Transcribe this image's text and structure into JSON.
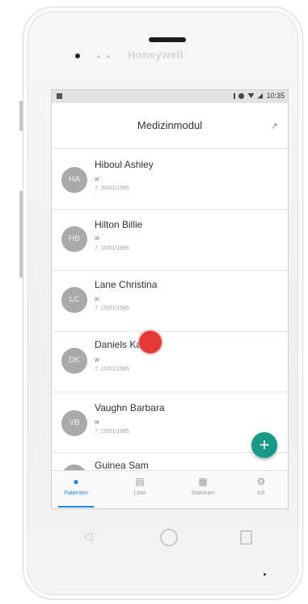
{
  "device": {
    "brand": "Honeywell"
  },
  "statusbar": {
    "time": "10:35"
  },
  "appbar": {
    "title": "Medizinmodul",
    "expand_icon": "expand-icon"
  },
  "patients": [
    {
      "initials": "HA",
      "name": "Hiboul Ashley",
      "sex": "w",
      "dob": "7. 30/01/1985"
    },
    {
      "initials": "HB",
      "name": "Hilton Billie",
      "sex": "w",
      "dob": "7. 15/01/1985"
    },
    {
      "initials": "LC",
      "name": "Lane Christina",
      "sex": "w",
      "dob": "7. 15/01/1985"
    },
    {
      "initials": "DK",
      "name": "Daniels Karen",
      "sex": "w",
      "dob": "7. 15/01/1985"
    },
    {
      "initials": "VB",
      "name": "Vaughn Barbara",
      "sex": "w",
      "dob": "7. 15/01/1985"
    },
    {
      "initials": "GS",
      "name": "Guinea Sam",
      "sex": "",
      "dob": ""
    }
  ],
  "fab": {
    "label": "+"
  },
  "bottomnav": [
    {
      "label": "Patienten",
      "icon": "person-icon",
      "active": true
    },
    {
      "label": "Liste",
      "icon": "list-icon",
      "active": false
    },
    {
      "label": "Stationen",
      "icon": "ward-icon",
      "active": false
    },
    {
      "label": "Ich",
      "icon": "profile-icon",
      "active": false
    }
  ],
  "colors": {
    "accent": "#1e88e5",
    "fab": "#1a9a86",
    "touch_indicator": "#e53935",
    "avatar": "#a9a9a9"
  }
}
